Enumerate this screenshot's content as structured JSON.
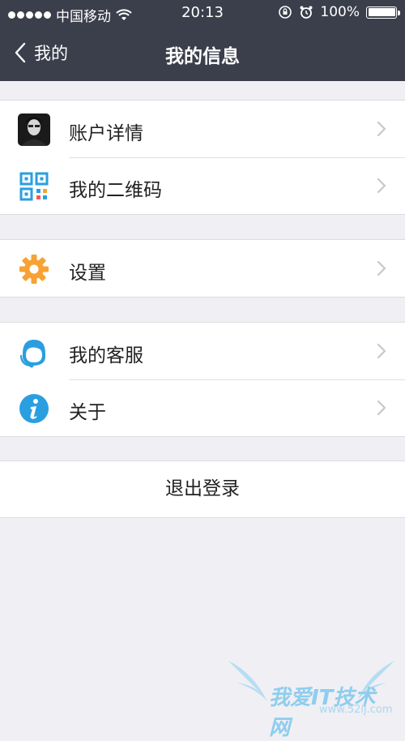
{
  "status_bar": {
    "carrier": "中国移动",
    "time": "20:13",
    "battery": "100%",
    "signal_icon": "signal-dots-icon",
    "wifi_icon": "wifi-icon",
    "lock_icon": "orientation-lock-icon",
    "alarm_icon": "alarm-icon",
    "battery_icon": "battery-icon"
  },
  "nav": {
    "back_label": "我的",
    "title": "我的信息"
  },
  "groups": [
    {
      "items": [
        {
          "label": "账户详情",
          "icon": "avatar-icon"
        },
        {
          "label": "我的二维码",
          "icon": "qr-code-icon"
        }
      ]
    },
    {
      "items": [
        {
          "label": "设置",
          "icon": "gear-icon"
        }
      ]
    },
    {
      "items": [
        {
          "label": "我的客服",
          "icon": "customer-service-icon"
        },
        {
          "label": "关于",
          "icon": "info-icon"
        }
      ]
    }
  ],
  "logout_label": "退出登录",
  "watermark": {
    "text": "我爱IT技术网",
    "url": "www.52ij.com"
  },
  "colors": {
    "bar_bg": "#3b3f4b",
    "page_bg": "#efeff4",
    "accent_blue": "#2a9fe0",
    "gear_orange": "#f7a234"
  }
}
